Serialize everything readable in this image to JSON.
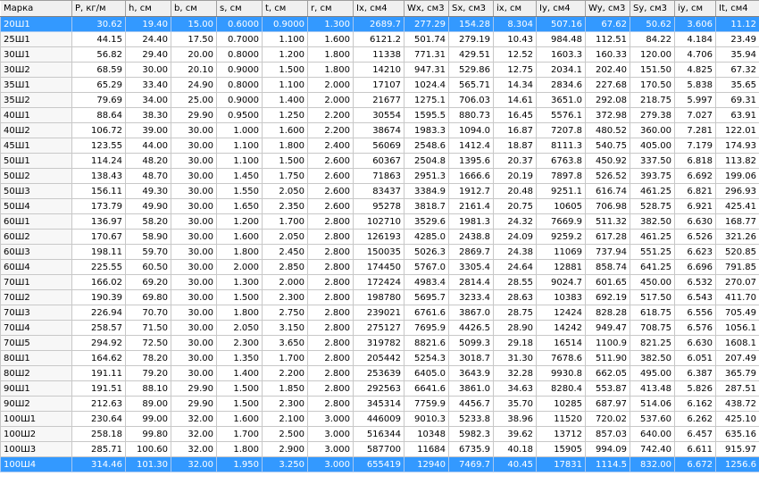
{
  "table": {
    "columns": [
      "Марка",
      "P, кг/м",
      "h, см",
      "b, см",
      "s, см",
      "t, см",
      "r, см",
      "Ix, см4",
      "Wx, см3",
      "Sx, см3",
      "ix, см",
      "Iy, см4",
      "Wy, см3",
      "Sy, см3",
      "iy, см",
      "It, см4"
    ],
    "rows": [
      [
        "20Ш1",
        "30.62",
        "19.40",
        "15.00",
        "0.6000",
        "0.9000",
        "1.300",
        "2689.7",
        "277.29",
        "154.28",
        "8.304",
        "507.16",
        "67.62",
        "50.62",
        "3.606",
        "11.12"
      ],
      [
        "25Ш1",
        "44.15",
        "24.40",
        "17.50",
        "0.7000",
        "1.100",
        "1.600",
        "6121.2",
        "501.74",
        "279.19",
        "10.43",
        "984.48",
        "112.51",
        "84.22",
        "4.184",
        "23.49"
      ],
      [
        "30Ш1",
        "56.82",
        "29.40",
        "20.00",
        "0.8000",
        "1.200",
        "1.800",
        "11338",
        "771.31",
        "429.51",
        "12.52",
        "1603.3",
        "160.33",
        "120.00",
        "4.706",
        "35.94"
      ],
      [
        "30Ш2",
        "68.59",
        "30.00",
        "20.10",
        "0.9000",
        "1.500",
        "1.800",
        "14210",
        "947.31",
        "529.86",
        "12.75",
        "2034.1",
        "202.40",
        "151.50",
        "4.825",
        "67.32"
      ],
      [
        "35Ш1",
        "65.29",
        "33.40",
        "24.90",
        "0.8000",
        "1.100",
        "2.000",
        "17107",
        "1024.4",
        "565.71",
        "14.34",
        "2834.6",
        "227.68",
        "170.50",
        "5.838",
        "35.65"
      ],
      [
        "35Ш2",
        "79.69",
        "34.00",
        "25.00",
        "0.9000",
        "1.400",
        "2.000",
        "21677",
        "1275.1",
        "706.03",
        "14.61",
        "3651.0",
        "292.08",
        "218.75",
        "5.997",
        "69.31"
      ],
      [
        "40Ш1",
        "88.64",
        "38.30",
        "29.90",
        "0.9500",
        "1.250",
        "2.200",
        "30554",
        "1595.5",
        "880.73",
        "16.45",
        "5576.1",
        "372.98",
        "279.38",
        "7.027",
        "63.91"
      ],
      [
        "40Ш2",
        "106.72",
        "39.00",
        "30.00",
        "1.000",
        "1.600",
        "2.200",
        "38674",
        "1983.3",
        "1094.0",
        "16.87",
        "7207.8",
        "480.52",
        "360.00",
        "7.281",
        "122.01"
      ],
      [
        "45Ш1",
        "123.55",
        "44.00",
        "30.00",
        "1.100",
        "1.800",
        "2.400",
        "56069",
        "2548.6",
        "1412.4",
        "18.87",
        "8111.3",
        "540.75",
        "405.00",
        "7.179",
        "174.93"
      ],
      [
        "50Ш1",
        "114.24",
        "48.20",
        "30.00",
        "1.100",
        "1.500",
        "2.600",
        "60367",
        "2504.8",
        "1395.6",
        "20.37",
        "6763.8",
        "450.92",
        "337.50",
        "6.818",
        "113.82"
      ],
      [
        "50Ш2",
        "138.43",
        "48.70",
        "30.00",
        "1.450",
        "1.750",
        "2.600",
        "71863",
        "2951.3",
        "1666.6",
        "20.19",
        "7897.8",
        "526.52",
        "393.75",
        "6.692",
        "199.06"
      ],
      [
        "50Ш3",
        "156.11",
        "49.30",
        "30.00",
        "1.550",
        "2.050",
        "2.600",
        "83437",
        "3384.9",
        "1912.7",
        "20.48",
        "9251.1",
        "616.74",
        "461.25",
        "6.821",
        "296.93"
      ],
      [
        "50Ш4",
        "173.79",
        "49.90",
        "30.00",
        "1.650",
        "2.350",
        "2.600",
        "95278",
        "3818.7",
        "2161.4",
        "20.75",
        "10605",
        "706.98",
        "528.75",
        "6.921",
        "425.41"
      ],
      [
        "60Ш1",
        "136.97",
        "58.20",
        "30.00",
        "1.200",
        "1.700",
        "2.800",
        "102710",
        "3529.6",
        "1981.3",
        "24.32",
        "7669.9",
        "511.32",
        "382.50",
        "6.630",
        "168.77"
      ],
      [
        "60Ш2",
        "170.67",
        "58.90",
        "30.00",
        "1.600",
        "2.050",
        "2.800",
        "126193",
        "4285.0",
        "2438.8",
        "24.09",
        "9259.2",
        "617.28",
        "461.25",
        "6.526",
        "321.26"
      ],
      [
        "60Ш3",
        "198.11",
        "59.70",
        "30.00",
        "1.800",
        "2.450",
        "2.800",
        "150035",
        "5026.3",
        "2869.7",
        "24.38",
        "11069",
        "737.94",
        "551.25",
        "6.623",
        "520.85"
      ],
      [
        "60Ш4",
        "225.55",
        "60.50",
        "30.00",
        "2.000",
        "2.850",
        "2.800",
        "174450",
        "5767.0",
        "3305.4",
        "24.64",
        "12881",
        "858.74",
        "641.25",
        "6.696",
        "791.85"
      ],
      [
        "70Ш1",
        "166.02",
        "69.20",
        "30.00",
        "1.300",
        "2.000",
        "2.800",
        "172424",
        "4983.4",
        "2814.4",
        "28.55",
        "9024.7",
        "601.65",
        "450.00",
        "6.532",
        "270.07"
      ],
      [
        "70Ш2",
        "190.39",
        "69.80",
        "30.00",
        "1.500",
        "2.300",
        "2.800",
        "198780",
        "5695.7",
        "3233.4",
        "28.63",
        "10383",
        "692.19",
        "517.50",
        "6.543",
        "411.70"
      ],
      [
        "70Ш3",
        "226.94",
        "70.70",
        "30.00",
        "1.800",
        "2.750",
        "2.800",
        "239021",
        "6761.6",
        "3867.0",
        "28.75",
        "12424",
        "828.28",
        "618.75",
        "6.556",
        "705.49"
      ],
      [
        "70Ш4",
        "258.57",
        "71.50",
        "30.00",
        "2.050",
        "3.150",
        "2.800",
        "275127",
        "7695.9",
        "4426.5",
        "28.90",
        "14242",
        "949.47",
        "708.75",
        "6.576",
        "1056.1"
      ],
      [
        "70Ш5",
        "294.92",
        "72.50",
        "30.00",
        "2.300",
        "3.650",
        "2.800",
        "319782",
        "8821.6",
        "5099.3",
        "29.18",
        "16514",
        "1100.9",
        "821.25",
        "6.630",
        "1608.1"
      ],
      [
        "80Ш1",
        "164.62",
        "78.20",
        "30.00",
        "1.350",
        "1.700",
        "2.800",
        "205442",
        "5254.3",
        "3018.7",
        "31.30",
        "7678.6",
        "511.90",
        "382.50",
        "6.051",
        "207.49"
      ],
      [
        "80Ш2",
        "191.11",
        "79.20",
        "30.00",
        "1.400",
        "2.200",
        "2.800",
        "253639",
        "6405.0",
        "3643.9",
        "32.28",
        "9930.8",
        "662.05",
        "495.00",
        "6.387",
        "365.79"
      ],
      [
        "90Ш1",
        "191.51",
        "88.10",
        "29.90",
        "1.500",
        "1.850",
        "2.800",
        "292563",
        "6641.6",
        "3861.0",
        "34.63",
        "8280.4",
        "553.87",
        "413.48",
        "5.826",
        "287.51"
      ],
      [
        "90Ш2",
        "212.63",
        "89.00",
        "29.90",
        "1.500",
        "2.300",
        "2.800",
        "345314",
        "7759.9",
        "4456.7",
        "35.70",
        "10285",
        "687.97",
        "514.06",
        "6.162",
        "438.72"
      ],
      [
        "100Ш1",
        "230.64",
        "99.00",
        "32.00",
        "1.600",
        "2.100",
        "3.000",
        "446009",
        "9010.3",
        "5233.8",
        "38.96",
        "11520",
        "720.02",
        "537.60",
        "6.262",
        "425.10"
      ],
      [
        "100Ш2",
        "258.18",
        "99.80",
        "32.00",
        "1.700",
        "2.500",
        "3.000",
        "516344",
        "10348",
        "5982.3",
        "39.62",
        "13712",
        "857.03",
        "640.00",
        "6.457",
        "635.16"
      ],
      [
        "100Ш3",
        "285.71",
        "100.60",
        "32.00",
        "1.800",
        "2.900",
        "3.000",
        "587700",
        "11684",
        "6735.9",
        "40.18",
        "15905",
        "994.09",
        "742.40",
        "6.611",
        "915.97"
      ],
      [
        "100Ш4",
        "314.46",
        "101.30",
        "32.00",
        "1.950",
        "3.250",
        "3.000",
        "655419",
        "12940",
        "7469.7",
        "40.45",
        "17831",
        "1114.5",
        "832.00",
        "6.672",
        "1256.6"
      ]
    ],
    "selected_rows": [
      0,
      29
    ],
    "colors": {
      "selection": "#3399ff",
      "header": "#f0f0f0",
      "grid": "#c8c8c8"
    }
  }
}
